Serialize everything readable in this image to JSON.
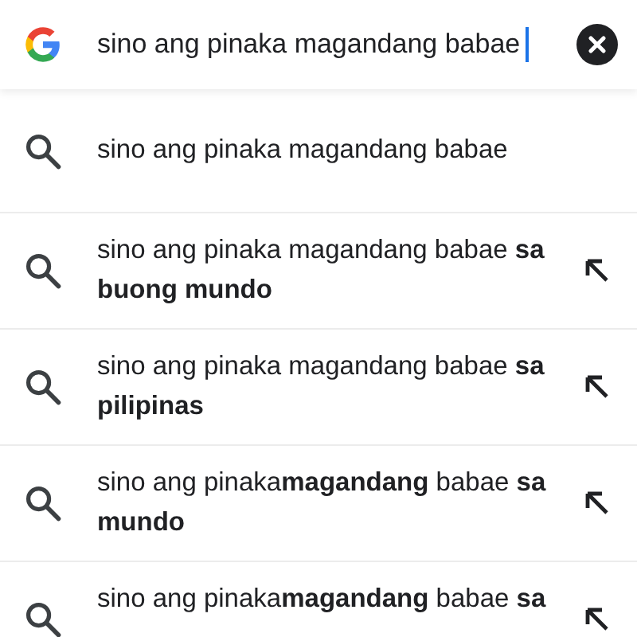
{
  "search": {
    "value": "sino ang pinaka magandang babae"
  },
  "suggestions": [
    {
      "kind": "exact",
      "text": "sino ang pinaka magandang babae"
    },
    {
      "kind": "completion",
      "text": "sino ang pinaka magandang babae **sa buong mundo**"
    },
    {
      "kind": "completion",
      "text": "sino ang pinaka magandang babae **sa pilipinas**"
    },
    {
      "kind": "completion",
      "text": "sino ang pinaka**magandang** babae **sa mundo**"
    },
    {
      "kind": "completion",
      "text": "sino ang pinaka**magandang** babae **sa**"
    }
  ]
}
